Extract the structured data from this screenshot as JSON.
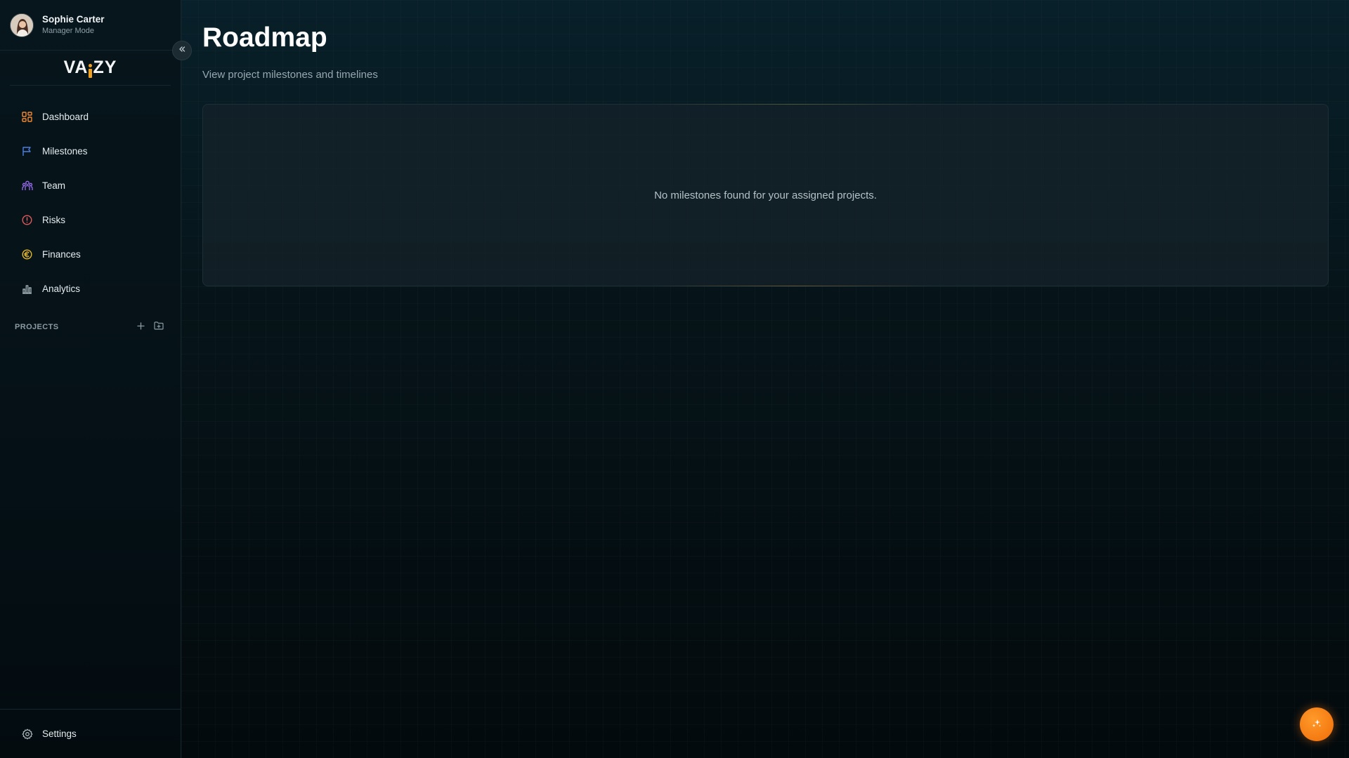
{
  "user": {
    "name": "Sophie Carter",
    "role": "Manager Mode"
  },
  "brand": {
    "logo_left": "VA",
    "logo_right": "ZY",
    "accent_color": "#f0a020"
  },
  "sidebar": {
    "items": [
      {
        "label": "Dashboard",
        "icon": "dashboard-grid-icon",
        "color": "#f28a2e"
      },
      {
        "label": "Milestones",
        "icon": "flag-icon",
        "color": "#4d7fe0"
      },
      {
        "label": "Team",
        "icon": "team-icon",
        "color": "#9a6cf0"
      },
      {
        "label": "Risks",
        "icon": "alert-circle-icon",
        "color": "#e05a5a"
      },
      {
        "label": "Finances",
        "icon": "euro-coin-icon",
        "color": "#e5b82a"
      },
      {
        "label": "Analytics",
        "icon": "bar-chart-icon",
        "color": "#a9b6bc"
      }
    ],
    "projects_title": "PROJECTS",
    "settings_label": "Settings"
  },
  "main": {
    "title": "Roadmap",
    "subtitle": "View project milestones and timelines",
    "empty_message": "No milestones found for your assigned projects."
  },
  "fab": {
    "icon": "sparkles-icon",
    "color": "#ef6c08"
  }
}
